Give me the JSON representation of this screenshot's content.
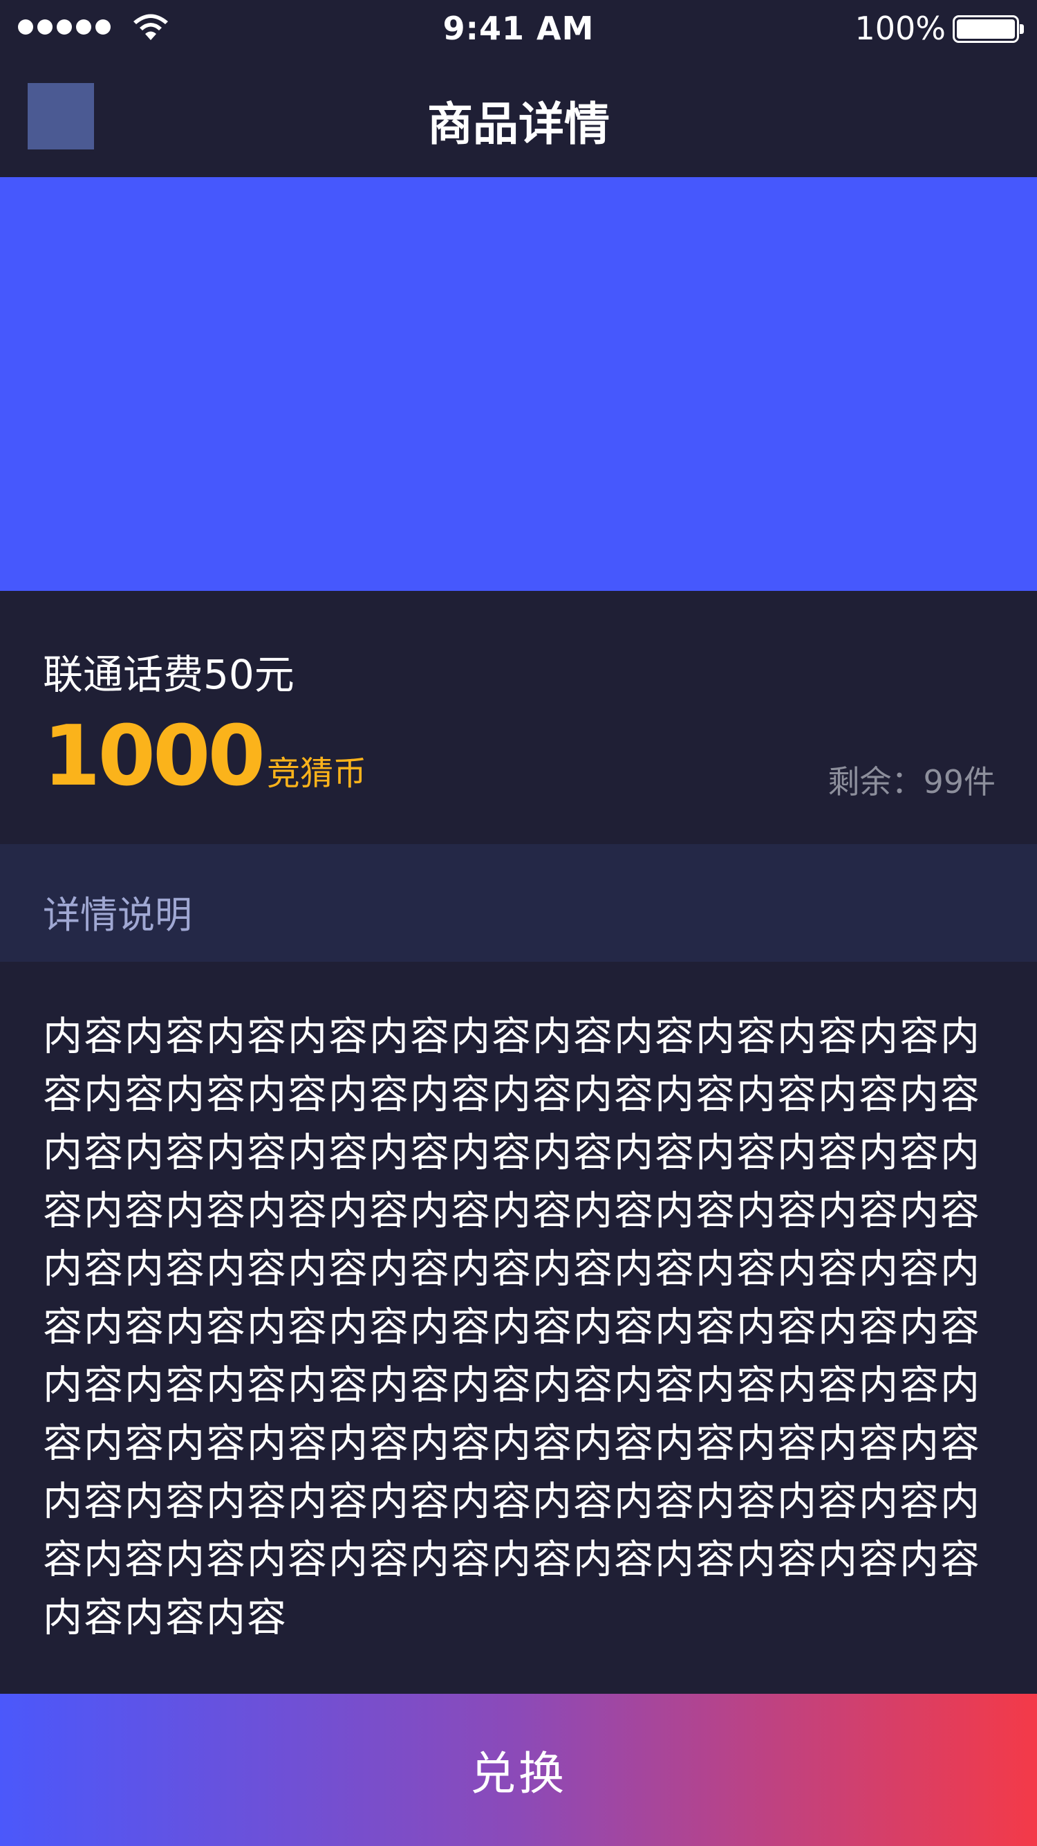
{
  "status_bar": {
    "time": "9:41 AM",
    "battery_percent": "100%",
    "signal_bars": 5,
    "wifi_icon": "wifi-icon",
    "battery_icon": "battery-icon"
  },
  "nav": {
    "title": "商品详情",
    "back_icon": "back-icon"
  },
  "hero": {
    "color": "#4658fd"
  },
  "product": {
    "name": "联通话费50元",
    "price": "1000",
    "price_unit": "竞猜币",
    "stock": "剩余：99件"
  },
  "details": {
    "title": "详情说明",
    "content": "内容内容内容内容内容内容内容内容内容内容内容内容内容内容内容内容内容内容内容内容内容内容内容内容内容内容内容内容内容内容内容内容内容内容内容内容内容内容内容内容内容内容内容内容内容内容内容内容内容内容内容内容内容内容内容内容内容内容内容内容内容内容内容内容内容内容内容内容内容内容内容内容内容内容内容内容内容内容内容内容内容内容内容内容内容内容内容内容内容内容内容内容内容内容内容内容内容内容内容内容内容内容内容内容内容内容内容内容内容内容内容内容内容内容内容内容内容内容"
  },
  "action": {
    "exchange_label": "兑换"
  },
  "colors": {
    "background": "#1f1f35",
    "accent_price": "#fbb31b",
    "details_header_bg": "#242847",
    "button_gradient_start": "#4b58fb",
    "button_gradient_end": "#f43a48"
  }
}
